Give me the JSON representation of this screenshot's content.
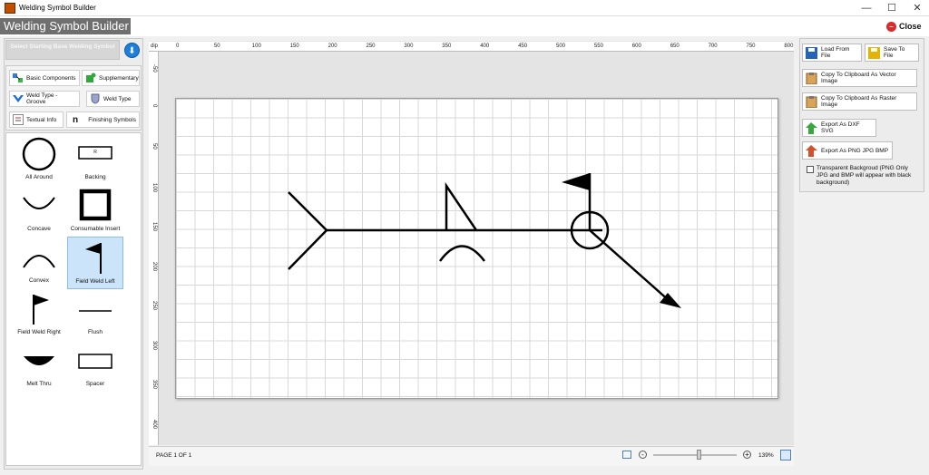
{
  "window": {
    "title": "Welding Symbol Builder",
    "minimize": "—",
    "maximize": "☐",
    "close": "✕"
  },
  "app": {
    "title": "Welding Symbol Builder",
    "close_label": "Close"
  },
  "left": {
    "base_button": "Select Starting Base Welding Symbol",
    "categories": [
      {
        "label": "Basic Components",
        "icon": "components-icon"
      },
      {
        "label": "Supplementary",
        "icon": "puzzle-icon"
      },
      {
        "label": "Weld Type - Groove",
        "icon": "groove-icon"
      },
      {
        "label": "Weld Type",
        "icon": "shield-icon"
      },
      {
        "label": "Textual Info",
        "icon": "text-icon"
      },
      {
        "label": "Finishing Symbols",
        "icon": "n-icon"
      }
    ],
    "symbols": [
      {
        "label": "All Around",
        "icon": "circle-icon"
      },
      {
        "label": "Backing",
        "icon": "backing-icon",
        "inner": "R"
      },
      {
        "label": "Concave",
        "icon": "concave-icon"
      },
      {
        "label": "Consumable Insert",
        "icon": "square-icon"
      },
      {
        "label": "Convex",
        "icon": "convex-icon"
      },
      {
        "label": "Field Weld Left",
        "icon": "flag-left-icon",
        "selected": true
      },
      {
        "label": "Field Weld Right",
        "icon": "flag-right-icon"
      },
      {
        "label": "Flush",
        "icon": "line-icon"
      },
      {
        "label": "Melt Thru",
        "icon": "melt-icon"
      },
      {
        "label": "Spacer",
        "icon": "rectangle-icon"
      }
    ]
  },
  "ruler": {
    "unit": "dip",
    "h_ticks": [
      "0",
      "50",
      "100",
      "150",
      "200",
      "250",
      "300",
      "350",
      "400",
      "450",
      "500",
      "550",
      "600",
      "650",
      "700",
      "750",
      "800"
    ],
    "v_ticks": [
      "-50",
      "0",
      "50",
      "100",
      "150",
      "200",
      "250",
      "300",
      "350",
      "400",
      "45"
    ]
  },
  "status": {
    "page": "PAGE 1 OF 1",
    "zoom": "139%",
    "zoom_fraction": 0.55
  },
  "right": {
    "load": "Load From File",
    "save": "Save To File",
    "copy_vector": "Copy To Clipboard As Vector Image",
    "copy_raster": "Copy To Clipboard As Raster Image",
    "export_dxf": "Export As DXF SVG",
    "export_png": "Export As PNG JPG BMP",
    "transparent": "Transparent Backgroud (PNG Only JPG and BMP will appear with black background)"
  },
  "colors": {
    "accent": "#1e7fd8",
    "selected": "#cce4fa",
    "close": "#d92b2b",
    "title_bg": "#6f6f6f"
  }
}
